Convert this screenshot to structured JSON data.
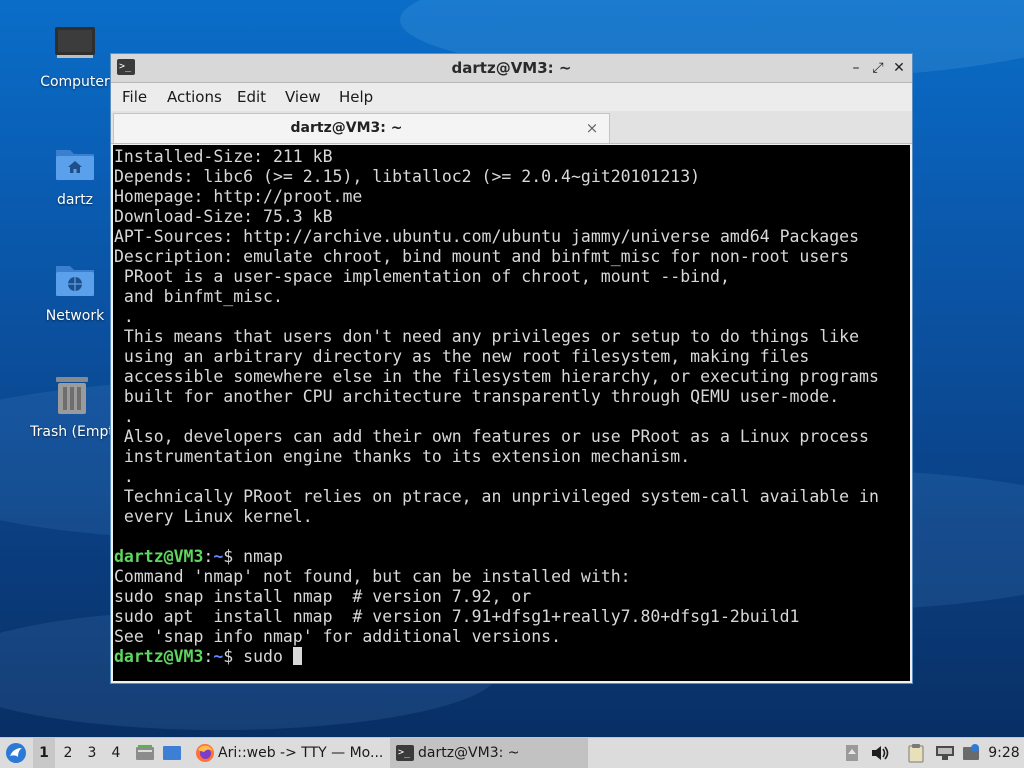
{
  "desktop": {
    "icons": [
      {
        "name": "Computer"
      },
      {
        "name": "dartz"
      },
      {
        "name": "Network"
      },
      {
        "name": "Trash (Empt"
      }
    ]
  },
  "window": {
    "title": "dartz@VM3: ~",
    "menu": [
      "File",
      "Actions",
      "Edit",
      "View",
      "Help"
    ],
    "tab_label": "dartz@VM3: ~",
    "tab_close": "×",
    "controls": {
      "minimize": "–",
      "maximize": "⤢",
      "close": "✕"
    }
  },
  "terminal": {
    "prompt_user": "dartz@VM3",
    "prompt_sep": ":",
    "prompt_path": "~",
    "prompt_sym": "$",
    "lines": [
      "Installed-Size: 211 kB",
      "Depends: libc6 (>= 2.15), libtalloc2 (>= 2.0.4~git20101213)",
      "Homepage: http://proot.me",
      "Download-Size: 75.3 kB",
      "APT-Sources: http://archive.ubuntu.com/ubuntu jammy/universe amd64 Packages",
      "Description: emulate chroot, bind mount and binfmt_misc for non-root users",
      " PRoot is a user-space implementation of chroot, mount --bind,",
      " and binfmt_misc.",
      " .",
      " This means that users don't need any privileges or setup to do things like",
      " using an arbitrary directory as the new root filesystem, making files",
      " accessible somewhere else in the filesystem hierarchy, or executing programs",
      " built for another CPU architecture transparently through QEMU user-mode.",
      " .",
      " Also, developers can add their own features or use PRoot as a Linux process",
      " instrumentation engine thanks to its extension mechanism.",
      " .",
      " Technically PRoot relies on ptrace, an unprivileged system-call available in",
      " every Linux kernel.",
      ""
    ],
    "command1": " nmap",
    "output": [
      "Command 'nmap' not found, but can be installed with:",
      "sudo snap install nmap  # version 7.92, or",
      "sudo apt  install nmap  # version 7.91+dfsg1+really7.80+dfsg1-2build1",
      "See 'snap info nmap' for additional versions."
    ],
    "current_input": " sudo "
  },
  "taskbar": {
    "workspaces": [
      "1",
      "2",
      "3",
      "4"
    ],
    "tasks": [
      {
        "label": "Ari::web -> TTY — Mo..."
      },
      {
        "label": "dartz@VM3: ~"
      }
    ],
    "clock": "9:28"
  }
}
